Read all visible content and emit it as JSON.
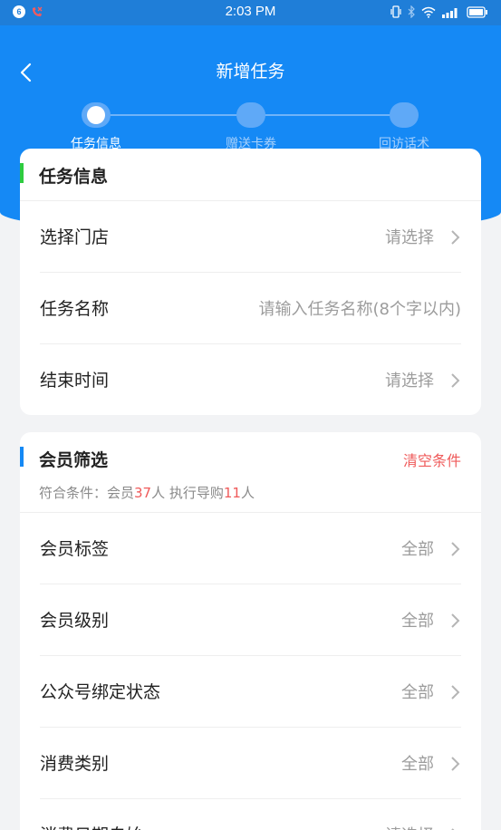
{
  "status_bar": {
    "time": "2:03 PM",
    "badge": "6"
  },
  "header": {
    "title": "新增任务"
  },
  "steps": [
    {
      "label": "任务信息",
      "active": true
    },
    {
      "label": "赠送卡券",
      "active": false
    },
    {
      "label": "回访话术",
      "active": false
    }
  ],
  "task_section": {
    "title": "任务信息",
    "accent_color": "#2ecc40",
    "rows": [
      {
        "label": "选择门店",
        "value": "请选择"
      },
      {
        "label": "任务名称",
        "placeholder": "请输入任务名称(8个字以内)"
      },
      {
        "label": "结束时间",
        "value": "请选择"
      }
    ]
  },
  "member_section": {
    "title": "会员筛选",
    "accent_color": "#1589f5",
    "clear_label": "清空条件",
    "criteria": {
      "prefix": "符合条件：会员",
      "member_count": "37",
      "middle": "人 执行导购",
      "guide_count": "11",
      "suffix": "人"
    },
    "rows": [
      {
        "label": "会员标签",
        "value": "全部"
      },
      {
        "label": "会员级别",
        "value": "全部"
      },
      {
        "label": "公众号绑定状态",
        "value": "全部"
      },
      {
        "label": "消费类别",
        "value": "全部"
      },
      {
        "label": "消费日期自始",
        "value": "请选择"
      }
    ]
  },
  "colors": {
    "primary": "#1589f5",
    "danger": "#ef5a5a",
    "text": "#222222",
    "muted": "#9c9c9c"
  }
}
